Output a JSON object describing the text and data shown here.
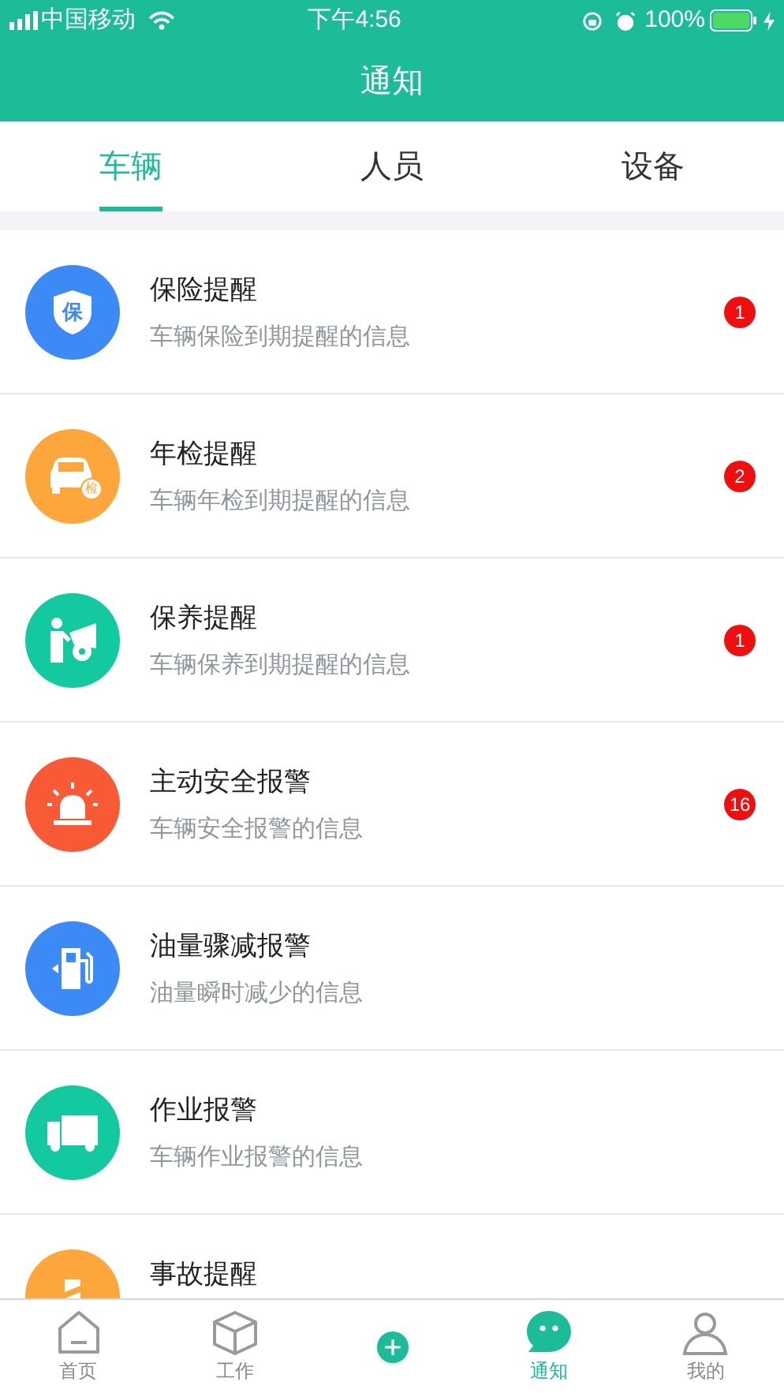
{
  "status_bar": {
    "carrier": "中国移动",
    "time": "下午4:56",
    "battery": "100%"
  },
  "header": {
    "title": "通知"
  },
  "tabs": [
    {
      "label": "车辆",
      "selected": true
    },
    {
      "label": "人员",
      "selected": false
    },
    {
      "label": "设备",
      "selected": false
    }
  ],
  "notifications": [
    {
      "kind": "shield",
      "icon_text": "保",
      "color": "#3b8af5",
      "title": "保险提醒",
      "subtitle": "车辆保险到期提醒的信息",
      "badge": "1"
    },
    {
      "kind": "car",
      "icon_text": "检",
      "color": "#fca63c",
      "title": "年检提醒",
      "subtitle": "车辆年检到期提醒的信息",
      "badge": "2"
    },
    {
      "kind": "mechanic",
      "color": "#12c9a0",
      "title": "保养提醒",
      "subtitle": "车辆保养到期提醒的信息",
      "badge": "1"
    },
    {
      "kind": "alarm",
      "color": "#f95a36",
      "title": "主动安全报警",
      "subtitle": "车辆安全报警的信息",
      "badge": "16"
    },
    {
      "kind": "fuel",
      "color": "#3b8af5",
      "title": "油量骤减报警",
      "subtitle": "油量瞬时减少的信息"
    },
    {
      "kind": "truck",
      "color": "#12c9a0",
      "title": "作业报警",
      "subtitle": "车辆作业报警的信息"
    },
    {
      "kind": "accident",
      "color": "#fca63c",
      "title": "事故提醒"
    }
  ],
  "tab_bar": [
    {
      "kind": "home",
      "label": "首页",
      "selected": false
    },
    {
      "kind": "work",
      "label": "工作",
      "selected": false
    },
    {
      "kind": "add"
    },
    {
      "kind": "chat",
      "label": "通知",
      "selected": true
    },
    {
      "kind": "person",
      "label": "我的",
      "selected": false
    }
  ]
}
